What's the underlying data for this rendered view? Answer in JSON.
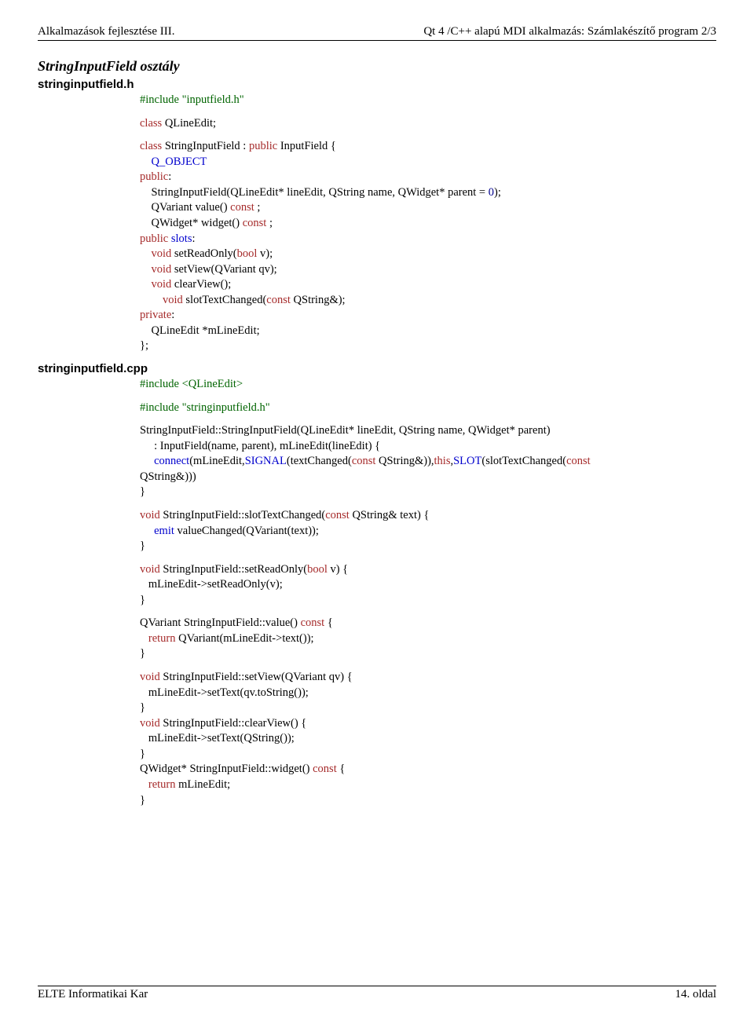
{
  "header": {
    "left": "Alkalmazások fejlesztése III.",
    "right": "Qt 4 /C++ alapú MDI alkalmazás: Számlakészítő program 2/3"
  },
  "section_title": "StringInputField osztály",
  "file_h_label": "stringinputfield.h",
  "file_cpp_label": "stringinputfield.cpp",
  "code_h1": {
    "include": "#include",
    "include_file": "\"inputfield.h\""
  },
  "code_h2_line": {
    "kw": "class",
    "text": "QLineEdit;"
  },
  "code_h3": {
    "l1a": "class",
    "l1b": "StringInputField : ",
    "l1c": "public",
    "l1d": "InputField {",
    "l2": "Q_OBJECT",
    "l3a": "public",
    "l3b": ":",
    "l4a": "StringInputField(QLineEdit* lineEdit, QString name, QWidget* parent = ",
    "l4b": "0",
    "l4c": ");",
    "l5a": "QVariant value() ",
    "l5b": "const",
    "l5c": " ;",
    "l6a": "QWidget* widget() ",
    "l6b": "const",
    "l6c": " ;",
    "l7a": "public ",
    "l7b": "slots",
    "l7c": ":",
    "l8a": "void",
    "l8b": " setReadOnly(",
    "l8c": "bool",
    "l8d": " v);",
    "l9a": "void",
    "l9b": " setView(QVariant qv);",
    "l10a": "void",
    "l10b": " clearView();",
    "l11a": "void",
    "l11b": " slotTextChanged(",
    "l11c": "const",
    "l11d": " QString&);",
    "l12a": "private",
    "l12b": ":",
    "l13": "QLineEdit *mLineEdit;",
    "l14": "};"
  },
  "code_cpp": {
    "inc1a": "#include",
    "inc1b": " <QLineEdit>",
    "inc2a": "#include",
    "inc2b": " \"stringinputfield.h\"",
    "b1_l1": "StringInputField::StringInputField(QLineEdit* lineEdit, QString name, QWidget* parent)",
    "b1_l2": "     : InputField(name, parent), mLineEdit(lineEdit) {",
    "b1_l3a": "connect",
    "b1_l3b": "(mLineEdit,",
    "b1_l3c": "SIGNAL",
    "b1_l3d": "(textChanged(",
    "b1_l3e": "const",
    "b1_l3f": " QString&)),",
    "b1_l3g": "this",
    "b1_l3h": ",",
    "b1_l3i": "SLOT",
    "b1_l3j": "(slotTextChanged(",
    "b1_l3k": "const",
    "b1_l4": "QString&)))",
    "b1_l5": "}",
    "b2_l1a": "void",
    "b2_l1b": " StringInputField::slotTextChanged(",
    "b2_l1c": "const",
    "b2_l1d": " QString& text) {",
    "b2_l2a": "emit",
    "b2_l2b": " valueChanged(QVariant(text));",
    "b2_l3": "}",
    "b3_l1a": "void",
    "b3_l1b": " StringInputField::setReadOnly(",
    "b3_l1c": "bool",
    "b3_l1d": " v) {",
    "b3_l2": "   mLineEdit->setReadOnly(v);",
    "b3_l3": "}",
    "b4_l1a": "QVariant StringInputField::value() ",
    "b4_l1b": "const",
    "b4_l1c": " {",
    "b4_l2a": "return",
    "b4_l2b": " QVariant(mLineEdit->text());",
    "b4_l3": "}",
    "b5_l1a": "void",
    "b5_l1b": " StringInputField::setView(QVariant qv) {",
    "b5_l2": "   mLineEdit->setText(qv.toString());",
    "b5_l3": "}",
    "b6_l1a": "void",
    "b6_l1b": " StringInputField::clearView() {",
    "b6_l2": "   mLineEdit->setText(QString());",
    "b6_l3": "}",
    "b7_l1a": "QWidget* StringInputField::widget() ",
    "b7_l1b": "const",
    "b7_l1c": " {",
    "b7_l2a": "return",
    "b7_l2b": " mLineEdit;",
    "b7_l3": "}"
  },
  "footer": {
    "left": "ELTE Informatikai Kar",
    "right": "14. oldal"
  }
}
